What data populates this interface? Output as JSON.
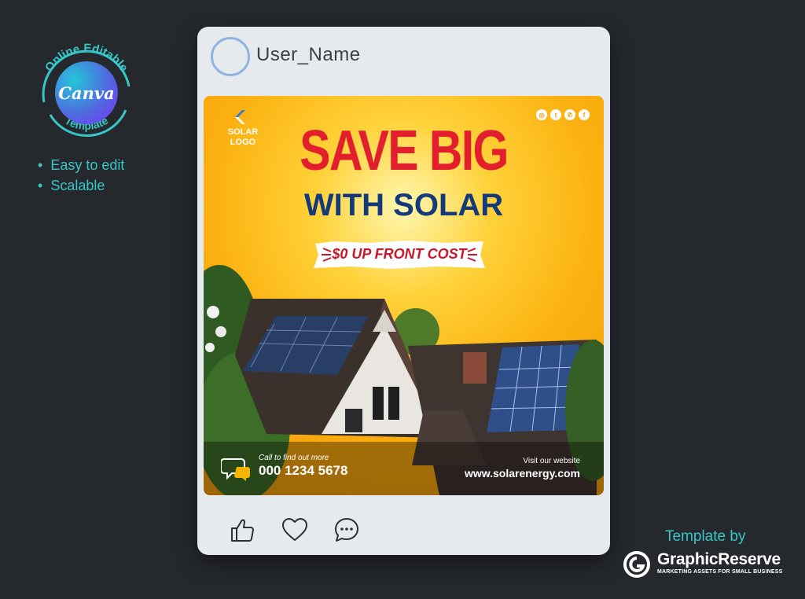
{
  "badge": {
    "arc_top_text": "Online Editable",
    "arc_bottom_text": "Template",
    "canva_word": "Canva",
    "colors": {
      "ring": "#37c7c7",
      "gradient_start": "#25c6d9",
      "gradient_end": "#7b2ff7"
    }
  },
  "features": [
    "Easy to edit",
    "Scalable"
  ],
  "post": {
    "username": "User_Name",
    "poster": {
      "logo_text": "SOLAR LOGO",
      "logo_icon": "solar-logo-icon",
      "social_icons": [
        "instagram-icon",
        "twitter-icon",
        "whatsapp-icon",
        "facebook-icon"
      ],
      "headline": "SAVE BIG",
      "subheadline": "WITH SOLAR",
      "cost_banner": "$0 UP FRONT COST",
      "call_label": "Call to find out more",
      "phone": "000 1234 5678",
      "website_label": "Visit our website",
      "website": "www.solarenergy.com",
      "colors": {
        "headline": "#e31e2d",
        "subheadline": "#153a7a",
        "background": "#fbb10f"
      }
    },
    "actions": [
      {
        "icon": "thumbs-up-icon"
      },
      {
        "icon": "heart-icon"
      },
      {
        "icon": "comment-icon"
      }
    ]
  },
  "credit": {
    "label": "Template by",
    "brand": "GraphicReserve",
    "tagline": "MARKETING ASSETS FOR SMALL BUSINESS",
    "colors": {
      "label": "#37c7c7"
    }
  }
}
